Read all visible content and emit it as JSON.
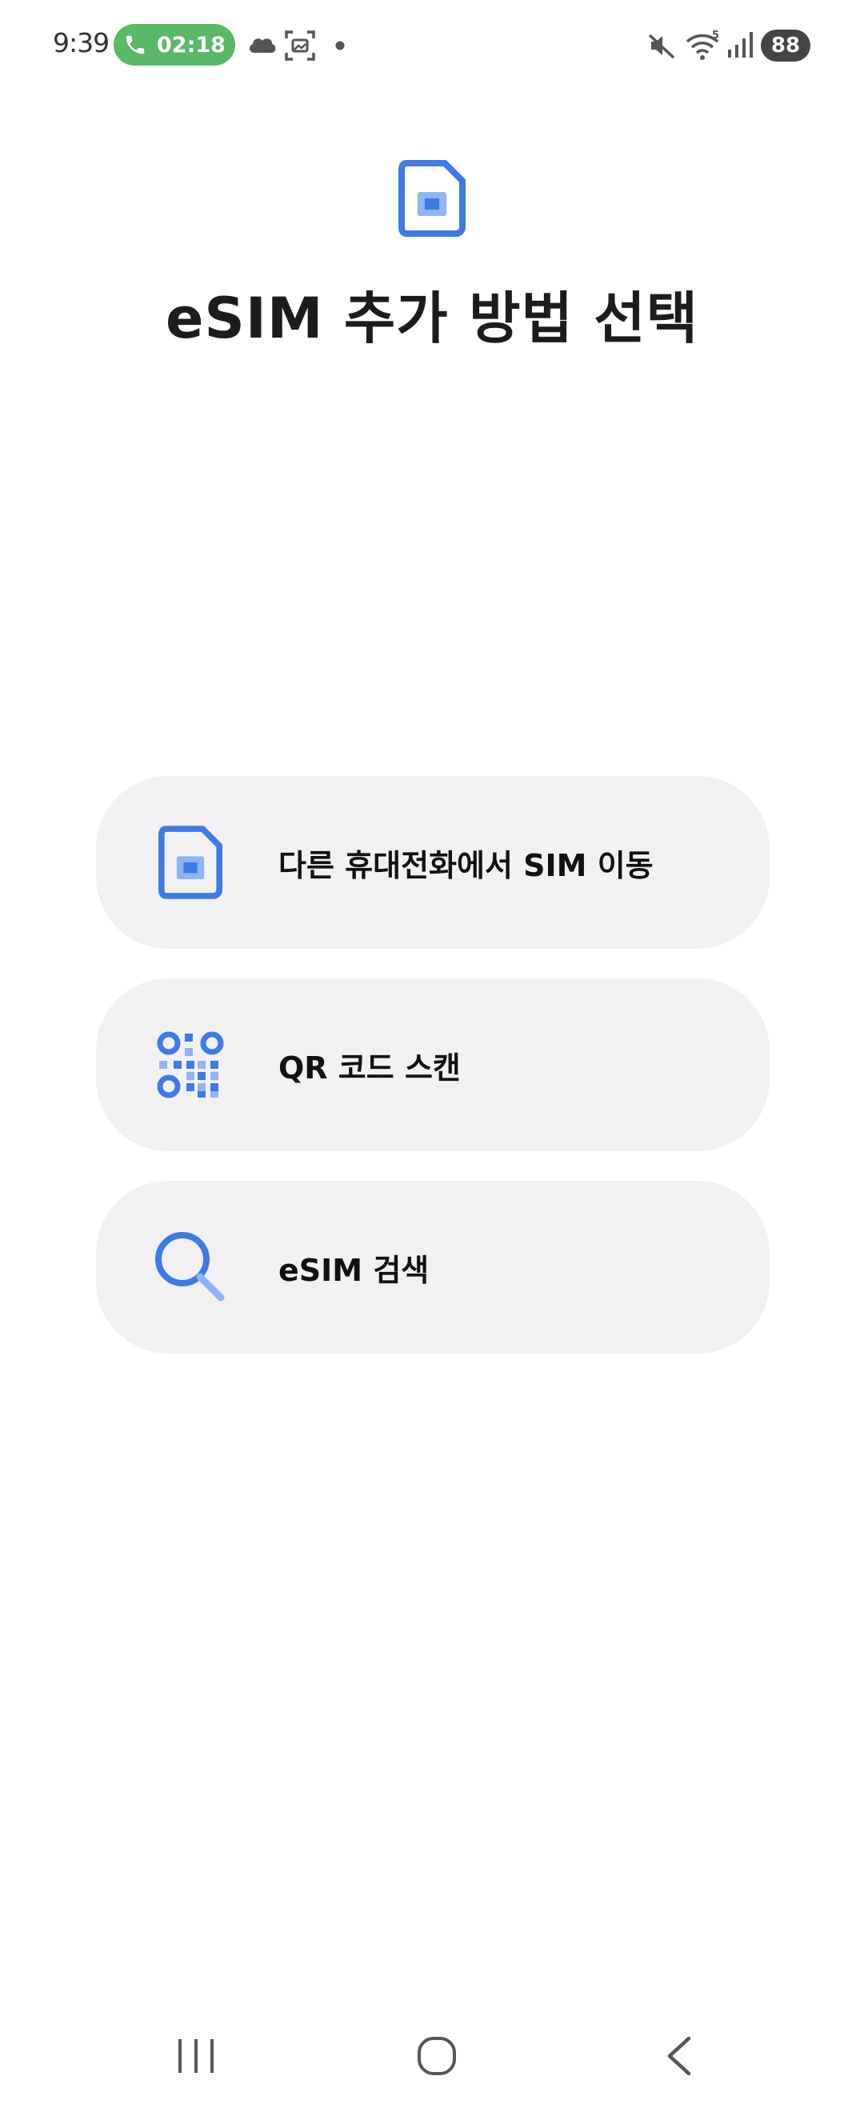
{
  "status_bar": {
    "time": "9:39",
    "call_duration": "02:18",
    "battery": "88"
  },
  "header": {
    "title": "eSIM 추가 방법 선택"
  },
  "options": [
    {
      "label": "다른 휴대전화에서 SIM 이동",
      "icon": "sim-card-icon"
    },
    {
      "label": "QR 코드 스캔",
      "icon": "qr-code-icon"
    },
    {
      "label": "eSIM 검색",
      "icon": "search-icon"
    }
  ],
  "colors": {
    "accent": "#3d7ae8",
    "accent_light": "#8fb3f5",
    "call_green": "#5ab966",
    "card_bg": "#f1f1f3",
    "nav_icon": "#555555"
  }
}
